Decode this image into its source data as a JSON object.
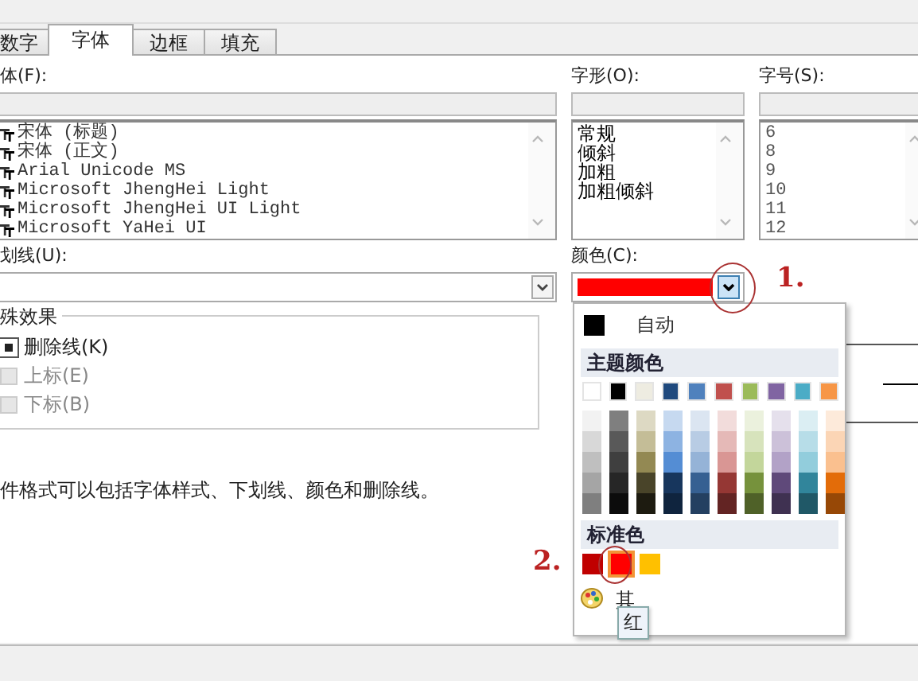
{
  "tabs": [
    {
      "label": "数字",
      "selected": false
    },
    {
      "label": "字体",
      "selected": true
    },
    {
      "label": "边框",
      "selected": false
    },
    {
      "label": "填充",
      "selected": false
    }
  ],
  "font": {
    "label": "体(F):",
    "items": [
      "宋体 (标题)",
      "宋体 (正文)",
      "Arial Unicode MS",
      "Microsoft JhengHei Light",
      "Microsoft JhengHei UI Light",
      "Microsoft YaHei UI"
    ]
  },
  "style": {
    "label": "字形(O):",
    "items": [
      "常规",
      "倾斜",
      "加粗",
      "加粗倾斜"
    ]
  },
  "size": {
    "label": "字号(S):",
    "items": [
      "6",
      "8",
      "9",
      "10",
      "11",
      "12"
    ]
  },
  "underline": {
    "label": "划线(U):"
  },
  "color": {
    "label": "颜色(C):",
    "color": "#ff0000"
  },
  "effects": {
    "title": "殊效果",
    "items": [
      {
        "label": "删除线(K)",
        "checked": true,
        "disabled": false
      },
      {
        "label": "上标(E)",
        "checked": false,
        "disabled": true
      },
      {
        "label": "下标(B)",
        "checked": false,
        "disabled": true
      }
    ]
  },
  "note": "件格式可以包括字体样式、下划线、颜色和删除线。",
  "color_menu": {
    "auto": {
      "label": "自动",
      "color": "#000000"
    },
    "theme_title": "主题颜色",
    "theme_colors": [
      {
        "color": "#ffffff",
        "shades": [
          {
            "color": "#f2f2f2"
          },
          {
            "color": "#d8d8d8"
          },
          {
            "color": "#bfbfbf"
          },
          {
            "color": "#a5a5a5"
          },
          {
            "color": "#7f7f7f"
          }
        ]
      },
      {
        "color": "#000000",
        "shades": [
          {
            "color": "#7f7f7f"
          },
          {
            "color": "#595959"
          },
          {
            "color": "#3f3f3f"
          },
          {
            "color": "#262626"
          },
          {
            "color": "#0c0c0c"
          }
        ]
      },
      {
        "color": "#eeece1",
        "shades": [
          {
            "color": "#ddd9c3"
          },
          {
            "color": "#c4bd97"
          },
          {
            "color": "#938953"
          },
          {
            "color": "#494429"
          },
          {
            "color": "#1d1b10"
          }
        ]
      },
      {
        "color": "#1f497d",
        "shades": [
          {
            "color": "#c6d9f0"
          },
          {
            "color": "#8db3e2"
          },
          {
            "color": "#548dd4"
          },
          {
            "color": "#17365d"
          },
          {
            "color": "#0f243e"
          }
        ]
      },
      {
        "color": "#4f81bd",
        "shades": [
          {
            "color": "#dbe5f1"
          },
          {
            "color": "#b8cce4"
          },
          {
            "color": "#95b3d7"
          },
          {
            "color": "#366092"
          },
          {
            "color": "#244061"
          }
        ]
      },
      {
        "color": "#c0504d",
        "shades": [
          {
            "color": "#f2dcdb"
          },
          {
            "color": "#e5b9b7"
          },
          {
            "color": "#d99694"
          },
          {
            "color": "#953734"
          },
          {
            "color": "#632423"
          }
        ]
      },
      {
        "color": "#9bbb59",
        "shades": [
          {
            "color": "#ebf1dd"
          },
          {
            "color": "#d7e3bc"
          },
          {
            "color": "#c3d69b"
          },
          {
            "color": "#76923c"
          },
          {
            "color": "#4f6128"
          }
        ]
      },
      {
        "color": "#8064a2",
        "shades": [
          {
            "color": "#e5e0ec"
          },
          {
            "color": "#ccc1d9"
          },
          {
            "color": "#b2a2c7"
          },
          {
            "color": "#5f497a"
          },
          {
            "color": "#3f3151"
          }
        ]
      },
      {
        "color": "#4bacc6",
        "shades": [
          {
            "color": "#dbeef3"
          },
          {
            "color": "#b7dde8"
          },
          {
            "color": "#92cddc"
          },
          {
            "color": "#31859b"
          },
          {
            "color": "#205867"
          }
        ]
      },
      {
        "color": "#f79646",
        "shades": [
          {
            "color": "#fdeada"
          },
          {
            "color": "#fbd5b5"
          },
          {
            "color": "#fac08f"
          },
          {
            "color": "#e36c09"
          },
          {
            "color": "#974806"
          }
        ]
      }
    ],
    "standard_title": "标准色",
    "standard_colors": [
      {
        "color": "#c00000",
        "selected": false
      },
      {
        "color": "#ff0000",
        "selected": true
      },
      {
        "color": "#ffc000",
        "selected": false
      }
    ],
    "more": "其",
    "tooltip": "红"
  },
  "annotations": [
    "1.",
    "2."
  ]
}
